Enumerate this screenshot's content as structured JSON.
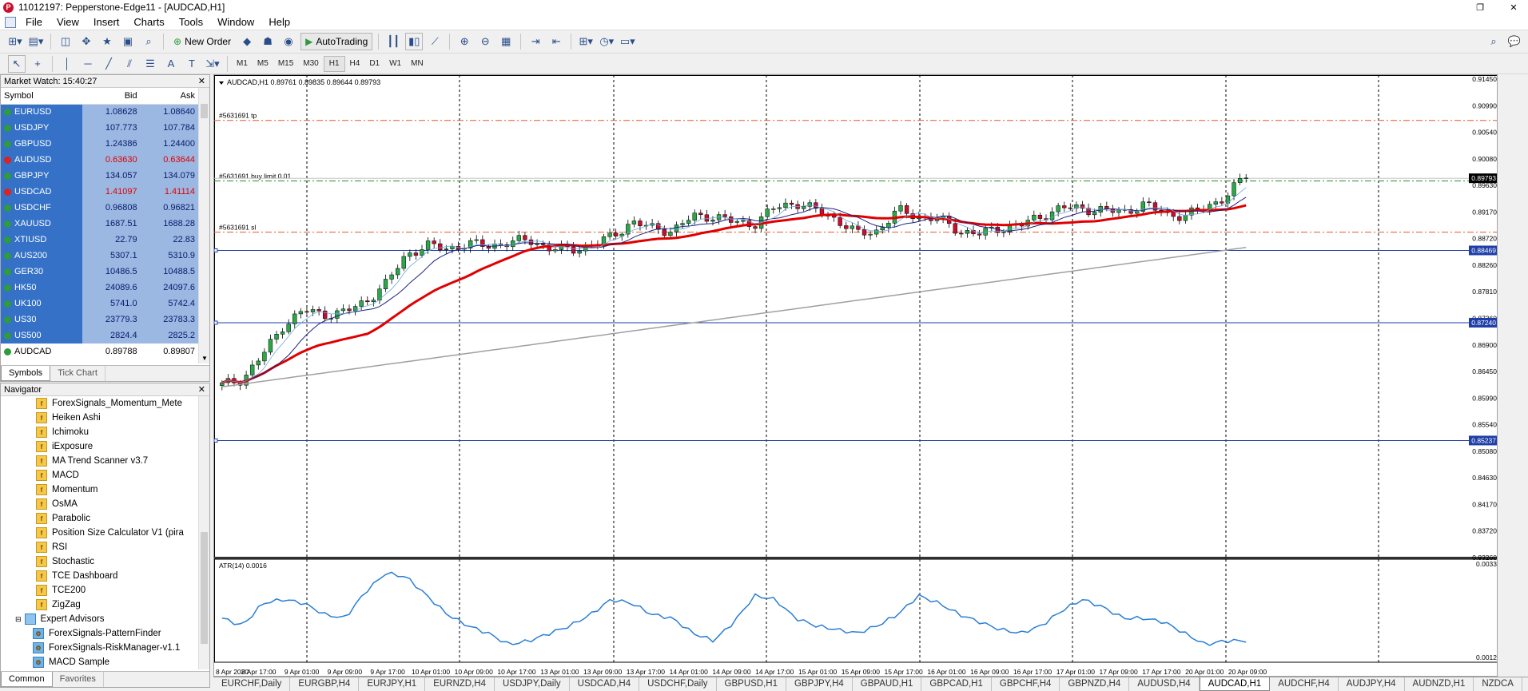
{
  "window": {
    "title": "11012197: Pepperstone-Edge11 - [AUDCAD,H1]",
    "icon_name": "pepperstone-logo-icon"
  },
  "menu": [
    "File",
    "View",
    "Insert",
    "Charts",
    "Tools",
    "Window",
    "Help"
  ],
  "toolbar": {
    "new_order_label": "New Order",
    "autotrading_label": "AutoTrading",
    "timeframes": [
      "M1",
      "M5",
      "M15",
      "M30",
      "H1",
      "H4",
      "D1",
      "W1",
      "MN"
    ],
    "active_timeframe": "H1"
  },
  "market_watch": {
    "title": "Market Watch: 15:40:27",
    "headers": {
      "symbol": "Symbol",
      "bid": "Bid",
      "ask": "Ask"
    },
    "rows": [
      {
        "symbol": "EURUSD",
        "bid": "1.08628",
        "ask": "1.08640",
        "dir": "up"
      },
      {
        "symbol": "USDJPY",
        "bid": "107.773",
        "ask": "107.784",
        "dir": "up"
      },
      {
        "symbol": "GBPUSD",
        "bid": "1.24386",
        "ask": "1.24400",
        "dir": "up"
      },
      {
        "symbol": "AUDUSD",
        "bid": "0.63630",
        "ask": "0.63644",
        "dir": "down"
      },
      {
        "symbol": "GBPJPY",
        "bid": "134.057",
        "ask": "134.079",
        "dir": "up"
      },
      {
        "symbol": "USDCAD",
        "bid": "1.41097",
        "ask": "1.41114",
        "dir": "down"
      },
      {
        "symbol": "USDCHF",
        "bid": "0.96808",
        "ask": "0.96821",
        "dir": "up"
      },
      {
        "symbol": "XAUUSD",
        "bid": "1687.51",
        "ask": "1688.28",
        "dir": "up"
      },
      {
        "symbol": "XTIUSD",
        "bid": "22.79",
        "ask": "22.83",
        "dir": "up"
      },
      {
        "symbol": "AUS200",
        "bid": "5307.1",
        "ask": "5310.9",
        "dir": "up"
      },
      {
        "symbol": "GER30",
        "bid": "10486.5",
        "ask": "10488.5",
        "dir": "up"
      },
      {
        "symbol": "HK50",
        "bid": "24089.6",
        "ask": "24097.6",
        "dir": "up"
      },
      {
        "symbol": "UK100",
        "bid": "5741.0",
        "ask": "5742.4",
        "dir": "up"
      },
      {
        "symbol": "US30",
        "bid": "23779.3",
        "ask": "23783.3",
        "dir": "up"
      },
      {
        "symbol": "US500",
        "bid": "2824.4",
        "ask": "2825.2",
        "dir": "up"
      },
      {
        "symbol": "AUDCAD",
        "bid": "0.89788",
        "ask": "0.89807",
        "dir": "up",
        "selected": true
      }
    ],
    "tabs": [
      "Symbols",
      "Tick Chart"
    ],
    "active_tab": "Symbols"
  },
  "navigator": {
    "title": "Navigator",
    "items": [
      {
        "label": "ForexSignals_Momentum_Mete",
        "type": "indicator"
      },
      {
        "label": "Heiken Ashi",
        "type": "indicator"
      },
      {
        "label": "Ichimoku",
        "type": "indicator"
      },
      {
        "label": "iExposure",
        "type": "indicator"
      },
      {
        "label": "MA Trend Scanner v3.7",
        "type": "indicator"
      },
      {
        "label": "MACD",
        "type": "indicator"
      },
      {
        "label": "Momentum",
        "type": "indicator"
      },
      {
        "label": "OsMA",
        "type": "indicator"
      },
      {
        "label": "Parabolic",
        "type": "indicator"
      },
      {
        "label": "Position Size Calculator V1 (pira",
        "type": "indicator"
      },
      {
        "label": "RSI",
        "type": "indicator"
      },
      {
        "label": "Stochastic",
        "type": "indicator"
      },
      {
        "label": "TCE Dashboard",
        "type": "indicator"
      },
      {
        "label": "TCE200",
        "type": "indicator"
      },
      {
        "label": "ZigZag",
        "type": "indicator"
      },
      {
        "label": "Expert Advisors",
        "type": "folder"
      },
      {
        "label": "ForexSignals-PatternFinder",
        "type": "ea"
      },
      {
        "label": "ForexSignals-RiskManager-v1.1",
        "type": "ea"
      },
      {
        "label": "MACD Sample",
        "type": "ea"
      }
    ],
    "tabs": [
      "Common",
      "Favorites"
    ],
    "active_tab": "Common"
  },
  "chart": {
    "header": "AUDCAD,H1  0.89761 0.89835 0.89644 0.89793",
    "order_lines": [
      {
        "label": "#5631691 tp",
        "price": 0.9068,
        "color": "#e05a2a"
      },
      {
        "label": "#5631691 buy limit 0.01",
        "price": 0.8965,
        "color": "#2a8a2a"
      },
      {
        "label": "#5631691 sl",
        "price": 0.8878,
        "color": "#e05a2a"
      }
    ],
    "hlines": [
      {
        "price": 0.88469,
        "label": "0.88469"
      },
      {
        "price": 0.8724,
        "label": "0.87240"
      },
      {
        "price": 0.85237,
        "label": "0.85237"
      }
    ],
    "current_price_label": "0.89793",
    "price_axis": [
      "0.91450",
      "0.90990",
      "0.90540",
      "0.90080",
      "0.89630",
      "0.89170",
      "0.88720",
      "0.88260",
      "0.87810",
      "0.87360",
      "0.86900",
      "0.86450",
      "0.85990",
      "0.85540",
      "0.85080",
      "0.84630",
      "0.84170",
      "0.83720",
      "0.83260"
    ],
    "time_axis": [
      "8 Apr 2020",
      "8 Apr 17:00",
      "9 Apr 01:00",
      "9 Apr 09:00",
      "9 Apr 17:00",
      "10 Apr 01:00",
      "10 Apr 09:00",
      "10 Apr 17:00",
      "13 Apr 01:00",
      "13 Apr 09:00",
      "13 Apr 17:00",
      "14 Apr 01:00",
      "14 Apr 09:00",
      "14 Apr 17:00",
      "15 Apr 01:00",
      "15 Apr 09:00",
      "15 Apr 17:00",
      "16 Apr 01:00",
      "16 Apr 09:00",
      "16 Apr 17:00",
      "17 Apr 01:00",
      "17 Apr 09:00",
      "17 Apr 17:00",
      "20 Apr 01:00",
      "20 Apr 09:00"
    ],
    "atr_label": "ATR(14) 0.0016",
    "atr_axis": [
      "0.0033",
      "0.0012"
    ]
  },
  "chart_data": {
    "type": "line",
    "series": [
      {
        "name": "AUDCAD,H1",
        "values": [
          0.8618,
          0.8628,
          0.867,
          0.872,
          0.8745,
          0.8738,
          0.8742,
          0.876,
          0.879,
          0.884,
          0.8855,
          0.885,
          0.8858,
          0.8855,
          0.886,
          0.8865,
          0.885,
          0.8848,
          0.8855,
          0.887,
          0.8895,
          0.8885,
          0.888,
          0.8905,
          0.8905,
          0.8895,
          0.8892,
          0.892,
          0.8928,
          0.8915,
          0.89,
          0.8875,
          0.888,
          0.8915,
          0.8905,
          0.89,
          0.888,
          0.8875,
          0.8885,
          0.889,
          0.8905,
          0.892,
          0.8918,
          0.8915,
          0.8912,
          0.8925,
          0.891,
          0.8905,
          0.892,
          0.8938,
          0.8975
        ]
      },
      {
        "name": "ATR(14)",
        "values": [
          0.002,
          0.0018,
          0.0024,
          0.0025,
          0.0024,
          0.0021,
          0.002,
          0.0027,
          0.0032,
          0.0031,
          0.0026,
          0.0021,
          0.0018,
          0.0016,
          0.0013,
          0.0014,
          0.0016,
          0.0018,
          0.0021,
          0.0025,
          0.0024,
          0.0021,
          0.002,
          0.0016,
          0.0014,
          0.0019,
          0.0026,
          0.0025,
          0.002,
          0.0018,
          0.0017,
          0.0016,
          0.0018,
          0.0021,
          0.0026,
          0.0024,
          0.0021,
          0.0019,
          0.0017,
          0.0016,
          0.0018,
          0.0022,
          0.0025,
          0.0023,
          0.002,
          0.002,
          0.0019,
          0.0016,
          0.0013,
          0.0014,
          0.0014
        ]
      }
    ],
    "ylim": [
      0.8326,
      0.9145
    ],
    "atr_ylim": [
      0.001,
      0.0034
    ],
    "grid": false
  },
  "bottom_tabs": [
    "EURCHF,Daily",
    "EURGBP,H4",
    "EURJPY,H1",
    "EURNZD,H4",
    "USDJPY,Daily",
    "USDCAD,H4",
    "USDCHF,Daily",
    "GBPUSD,H1",
    "GBPJPY,H4",
    "GBPAUD,H1",
    "GBPCAD,H1",
    "GBPCHF,H4",
    "GBPNZD,H4",
    "AUDUSD,H4",
    "AUDCAD,H1",
    "AUDCHF,H4",
    "AUDJPY,H4",
    "AUDNZD,H1",
    "NZDCA"
  ],
  "active_bottom_tab": "AUDCAD,H1",
  "colors": {
    "selection": "#3471c7",
    "ma_red": "#e00000",
    "ma_gray": "#a0a0a0",
    "ma_navy": "#1a237e",
    "atr": "#2a7fd4",
    "bull": "#2ba84a",
    "bear": "#c8102e"
  }
}
